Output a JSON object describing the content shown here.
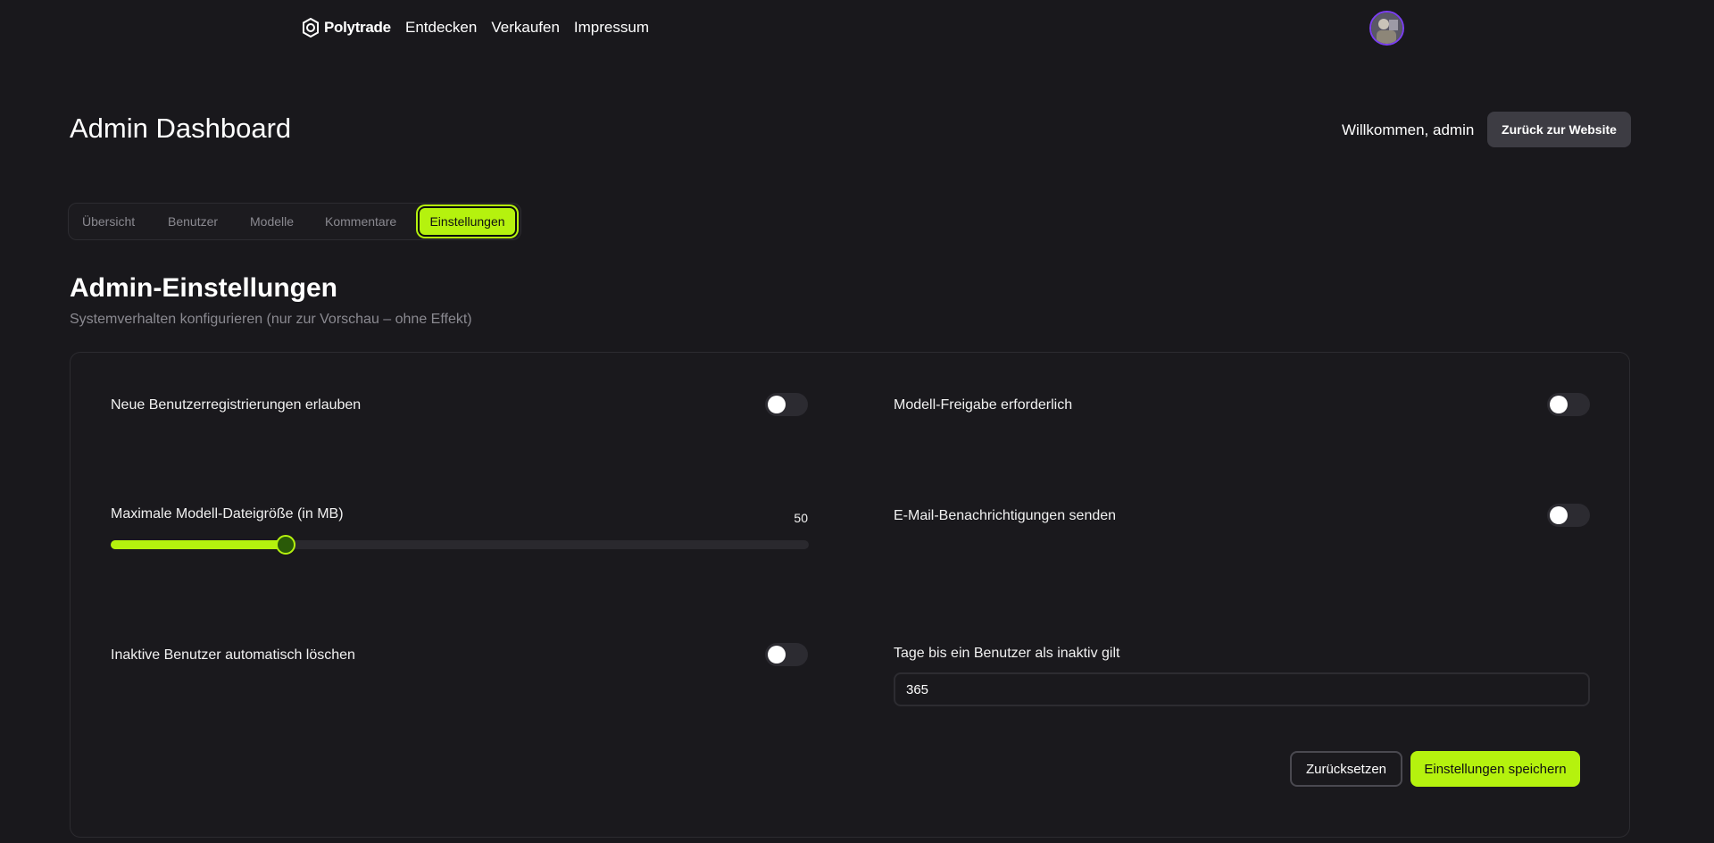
{
  "nav": {
    "brand": "Polytrade",
    "links": [
      "Entdecken",
      "Verkaufen",
      "Impressum"
    ]
  },
  "header": {
    "title": "Admin Dashboard",
    "welcome": "Willkommen, admin",
    "back_button": "Zurück zur Website"
  },
  "tabs": [
    {
      "label": "Übersicht",
      "active": false
    },
    {
      "label": "Benutzer",
      "active": false
    },
    {
      "label": "Modelle",
      "active": false
    },
    {
      "label": "Kommentare",
      "active": false
    },
    {
      "label": "Einstellungen",
      "active": true
    }
  ],
  "section": {
    "title": "Admin-Einstellungen",
    "subtitle": "Systemverhalten konfigurieren (nur zur Vorschau – ohne Effekt)"
  },
  "settings": {
    "allow_registrations": {
      "label": "Neue Benutzerregistrierungen erlauben",
      "enabled": false
    },
    "model_approval": {
      "label": "Modell-Freigabe erforderlich",
      "enabled": false
    },
    "max_file_size": {
      "label": "Maximale Modell-Dateigröße (in MB)",
      "value": 50,
      "min": 0,
      "max": 200
    },
    "email_notifications": {
      "label": "E-Mail-Benachrichtigungen senden",
      "enabled": false
    },
    "auto_delete_inactive": {
      "label": "Inaktive Benutzer automatisch löschen",
      "enabled": false
    },
    "inactive_days": {
      "label": "Tage bis ein Benutzer als inaktiv gilt",
      "value": "365"
    }
  },
  "actions": {
    "reset": "Zurücksetzen",
    "save": "Einstellungen speichern"
  },
  "colors": {
    "accent": "#b5f20e",
    "background": "#19181c"
  }
}
